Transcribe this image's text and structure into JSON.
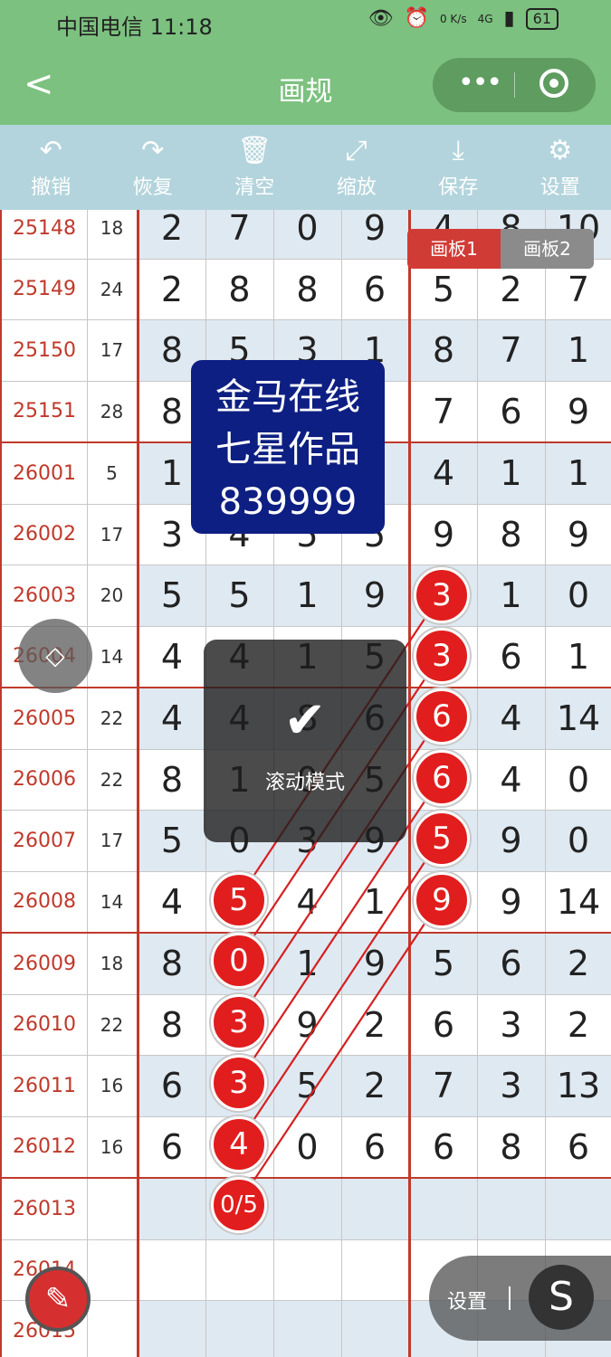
{
  "status": {
    "carrier": "中国电信 11:18",
    "net_speed": "0 K/s",
    "signal": "4G",
    "battery": "61"
  },
  "nav": {
    "back": "<",
    "title": "画规",
    "more": "•••"
  },
  "toolbar": [
    {
      "label": "撤销",
      "icon": "↶"
    },
    {
      "label": "恢复",
      "icon": "↷"
    },
    {
      "label": "清空",
      "icon": "🗑"
    },
    {
      "label": "缩放",
      "icon": "⤢"
    },
    {
      "label": "保存",
      "icon": "⤓"
    },
    {
      "label": "设置",
      "icon": "⚙"
    }
  ],
  "rows": [
    [
      "25148",
      "18",
      "2",
      "7",
      "0",
      "9",
      "4",
      "8",
      "10"
    ],
    [
      "25149",
      "24",
      "2",
      "8",
      "8",
      "6",
      "5",
      "2",
      "7"
    ],
    [
      "25150",
      "17",
      "8",
      "5",
      "3",
      "1",
      "8",
      "7",
      "1"
    ],
    [
      "25151",
      "28",
      "8",
      "",
      "",
      "",
      "7",
      "6",
      "9"
    ],
    [
      "26001",
      "5",
      "1",
      "",
      "",
      "",
      "4",
      "1",
      "1"
    ],
    [
      "26002",
      "17",
      "3",
      "4",
      "5",
      "5",
      "9",
      "8",
      "9"
    ],
    [
      "26003",
      "20",
      "5",
      "5",
      "1",
      "9",
      "",
      "1",
      "0"
    ],
    [
      "26004",
      "14",
      "4",
      "4",
      "1",
      "5",
      "",
      "6",
      "1"
    ],
    [
      "26005",
      "22",
      "4",
      "4",
      "8",
      "6",
      "",
      "4",
      "14"
    ],
    [
      "26006",
      "22",
      "8",
      "1",
      "0",
      "5",
      "",
      "4",
      "0"
    ],
    [
      "26007",
      "17",
      "5",
      "0",
      "3",
      "9",
      "",
      "9",
      "0"
    ],
    [
      "26008",
      "14",
      "4",
      "",
      "4",
      "1",
      "",
      "9",
      "14"
    ],
    [
      "26009",
      "18",
      "8",
      "",
      "1",
      "9",
      "5",
      "6",
      "2"
    ],
    [
      "26010",
      "22",
      "8",
      "",
      "9",
      "2",
      "6",
      "3",
      "2"
    ],
    [
      "26011",
      "16",
      "6",
      "",
      "5",
      "2",
      "7",
      "3",
      "13"
    ],
    [
      "26012",
      "16",
      "6",
      "",
      "0",
      "6",
      "6",
      "8",
      "6"
    ],
    [
      "26013",
      "",
      "",
      "",
      "",
      "",
      "",
      "",
      ""
    ],
    [
      "26014",
      "",
      "",
      "",
      "",
      "",
      "",
      "",
      ""
    ],
    [
      "26015",
      "",
      "",
      "",
      "",
      "",
      "",
      "",
      ""
    ]
  ],
  "board_tabs": {
    "tab1": "画板1",
    "tab2": "画板2"
  },
  "watermark": {
    "line1": "金马在线",
    "line2": "七星作品",
    "line3": "839999"
  },
  "toast": {
    "check": "✔",
    "message": "滚动模式"
  },
  "balls_right": [
    "3",
    "3",
    "6",
    "6",
    "5",
    "9"
  ],
  "balls_left": [
    "5",
    "0",
    "3",
    "3",
    "4",
    "0/5"
  ],
  "scroll_handle": "◇",
  "pen_button": "✎",
  "settings_pill": {
    "label": "设置",
    "s": "S"
  },
  "colors": {
    "header_green": "#7cc17f",
    "toolbar_blue": "#b3d4dc",
    "accent_red": "#d13b35",
    "badge_navy": "#0d1f82"
  }
}
